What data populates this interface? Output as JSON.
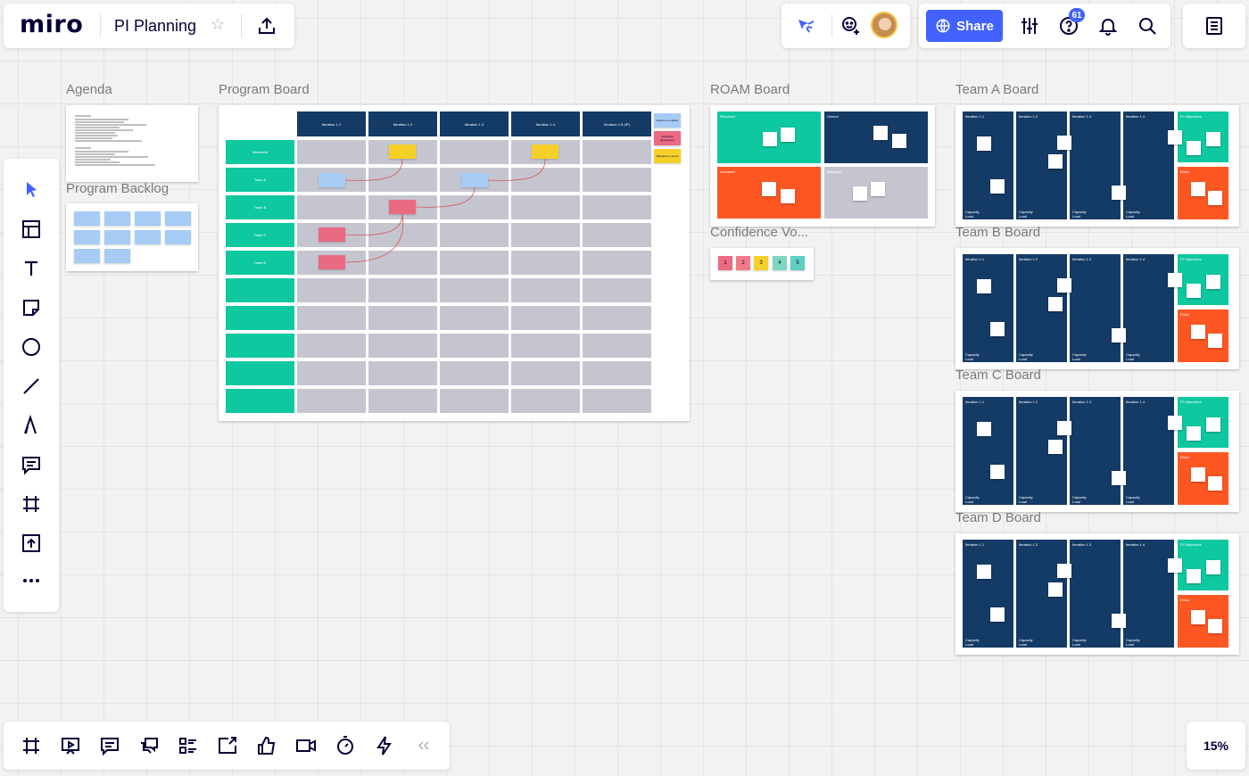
{
  "app": {
    "logo": "miro",
    "board_title": "PI Planning",
    "share_label": "Share",
    "notifications_count": "61",
    "zoom": "15%"
  },
  "toolbar_left": [
    "select-icon",
    "templates-icon",
    "text-icon",
    "sticky-note-icon",
    "shape-icon",
    "line-icon",
    "pen-icon",
    "comment-icon",
    "frame-icon",
    "upload-icon",
    "more-icon"
  ],
  "toolbar_bottom": [
    "frames-icon",
    "presentation-icon",
    "comments-icon",
    "chat-icon",
    "cards-icon",
    "share-screen-icon",
    "voting-icon",
    "video-icon",
    "timer-icon",
    "activity-icon",
    "collapse-icon"
  ],
  "frames": {
    "agenda": "Agenda",
    "program_backlog": "Program Backlog",
    "program_board": "Program Board",
    "roam_board": "ROAM Board",
    "confidence_vote": "Confidence Vo...",
    "team_a": "Team A Board",
    "team_b": "Team B Board",
    "team_c": "Team C Board",
    "team_d": "Team D Board"
  },
  "program_board": {
    "iterations": [
      "Iteration 1.1",
      "Iteration 1.2",
      "Iteration 1.3",
      "Iteration 1.4",
      "Iteration 1.5 (IP)"
    ],
    "rows": [
      "Milestone",
      "Team A",
      "Team B",
      "Team C",
      "Team D",
      "",
      "",
      "",
      "",
      ""
    ],
    "legend": [
      "Feature or enabler",
      "Significant dependency",
      "Milestone or event"
    ]
  },
  "roam": {
    "quadrants": [
      "Resolved",
      "Owned",
      "Accepted",
      "Mitigated"
    ]
  },
  "confidence": [
    "1",
    "2",
    "3",
    "4",
    "5"
  ],
  "team_board": {
    "iterations": [
      "Iteration 1.1",
      "Iteration 1.2",
      "Iteration 1.3",
      "Iteration 1.4"
    ],
    "objectives": "PI Objectives",
    "risks": "Risks",
    "capacity": "Capacity",
    "load": "Load"
  },
  "colors": {
    "teal": "#0ec8a0",
    "navy": "#143b66",
    "orange": "#ff5722",
    "gray_cell": "#c5c5d0",
    "blue_sticky": "#a6ccf5",
    "yellow_sticky": "#f5d128",
    "pink_sticky": "#ea6a82",
    "accent": "#4262ff"
  }
}
